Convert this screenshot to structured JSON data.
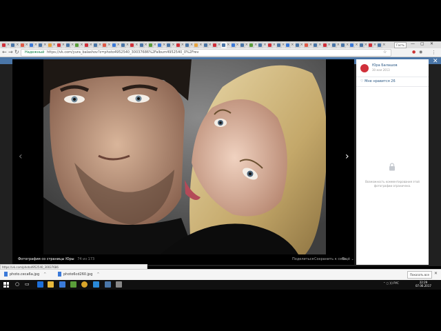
{
  "browser": {
    "secure_label": "Надежный",
    "url": "https://vk.com/yura_balashov?z=photo4952540_30037686%2Falbum4952540_0%2Frev",
    "user_badge": "Гость",
    "tab_colors": [
      "#d0303a",
      "#4a76a8",
      "#e05a47",
      "#3b7ad9",
      "#4a76a8",
      "#e8a33d",
      "#d0303a",
      "#4a76a8",
      "#5a9e3a",
      "#d0303a",
      "#4a76a8",
      "#e05a47",
      "#3b7ad9",
      "#4a76a8",
      "#d0303a",
      "#4a76a8",
      "#5a9e3a",
      "#3b7ad9",
      "#4a76a8",
      "#d0303a",
      "#4a76a8",
      "#e8a33d",
      "#4a76a8",
      "#d0303a",
      "#4a76a8",
      "#3b7ad9",
      "#4a76a8",
      "#5a9e3a",
      "#4a76a8",
      "#d0303a",
      "#4a76a8",
      "#3b7ad9",
      "#4a76a8",
      "#e05a47",
      "#4a76a8",
      "#d0303a",
      "#4a76a8",
      "#4a76a8",
      "#3b7ad9",
      "#4a76a8",
      "#d0303a",
      "#4a76a8"
    ]
  },
  "viewer": {
    "caption": "Фотография со страницы Юры",
    "count": "74 из 173",
    "share": "Поделиться",
    "save": "Сохранить к себе",
    "more": "Ещё ⌄"
  },
  "status_url": "https://vk.com/photo4952540_30037686",
  "panel": {
    "author": "Юра Балашов",
    "date": "30 мая 2013",
    "likes": "Мне нравится  26",
    "comments_disabled": "Возможность комментирования этой фотографии ограничена."
  },
  "downloads": [
    {
      "name": "photo.ceca6a.jpg"
    },
    {
      "name": "photo6cd260.jpg"
    }
  ],
  "downloads_showall": "Показать все",
  "taskbar": {
    "tray": "⌃  ◻ ))) РУС",
    "time": "22:29",
    "date": "07.06.2017"
  },
  "colors": {
    "vk_blue": "#4a76a8",
    "overlay": "#202020"
  }
}
